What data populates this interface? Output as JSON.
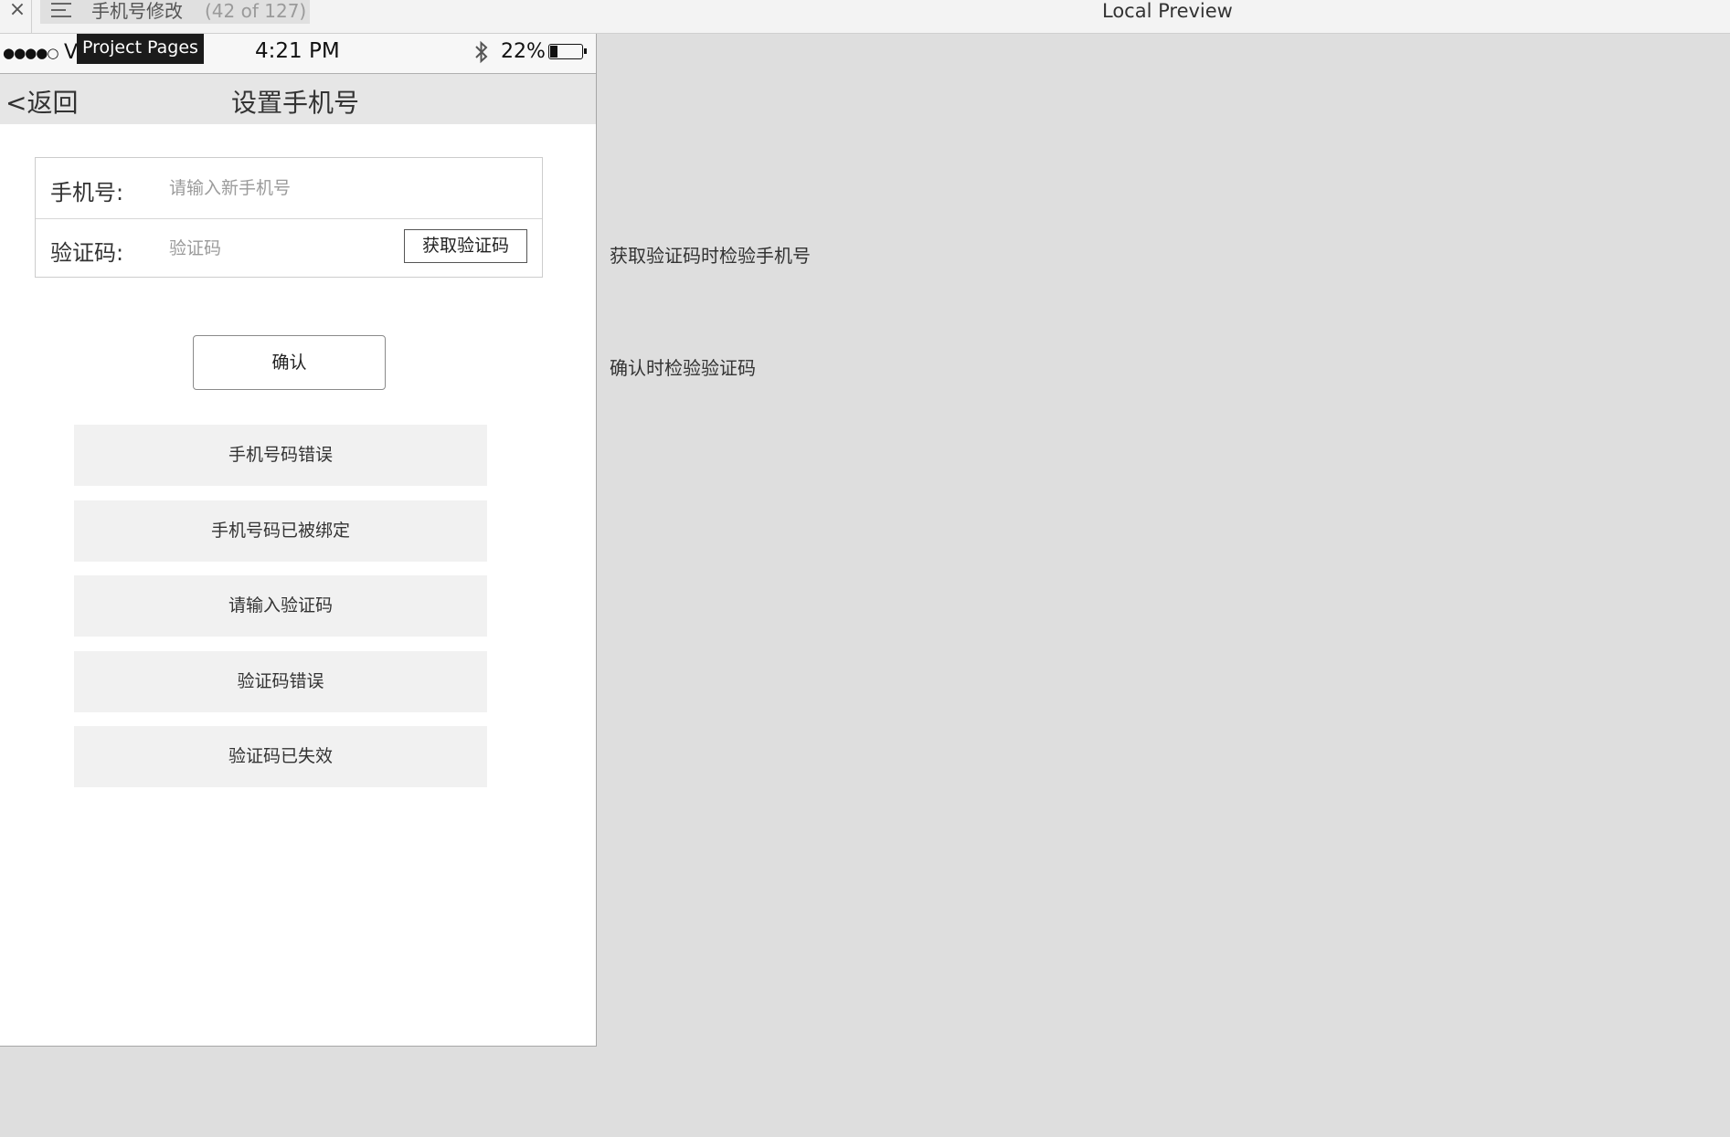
{
  "toolbar": {
    "close_symbol": "×",
    "page_name": "手机号修改",
    "page_count": "(42 of 127)",
    "preview_title": "Local Preview",
    "tooltip": "Project Pages"
  },
  "status_bar": {
    "signal": "●●●●○",
    "carrier": "V",
    "time": "4:21 PM",
    "battery_percent": "22%",
    "battery_level": 0.22
  },
  "nav": {
    "back_label": "<返回",
    "title": "设置手机号"
  },
  "form": {
    "phone_label": "手机号:",
    "phone_placeholder": "请输入新手机号",
    "code_label": "验证码:",
    "code_placeholder": "验证码",
    "get_code_label": "获取验证码"
  },
  "confirm_label": "确认",
  "messages": [
    "手机号码错误",
    "手机号码已被绑定",
    "请输入验证码",
    "验证码错误",
    "验证码已失效"
  ],
  "notes": {
    "get_code_note": "获取验证码时检验手机号",
    "confirm_note": "确认时检验验证码"
  }
}
